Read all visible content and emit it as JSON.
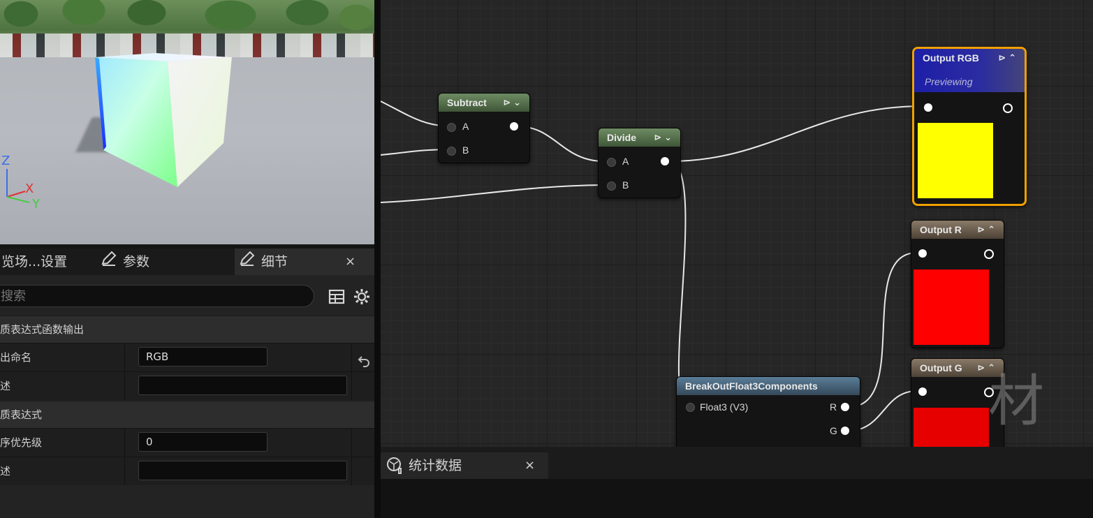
{
  "tabs": [
    {
      "label": "览场...设置",
      "active": false
    },
    {
      "label": "参数",
      "active": false
    },
    {
      "label": "细节",
      "active": true
    }
  ],
  "tab_close": "×",
  "search": {
    "placeholder": "搜索",
    "value": ""
  },
  "sections": [
    {
      "title": "质表达式函数输出"
    },
    {
      "title": "质表达式"
    }
  ],
  "props": {
    "output_name": {
      "label": "出命名",
      "value": "RGB"
    },
    "description1": {
      "label": "述",
      "value": ""
    },
    "sort_priority": {
      "label": "序优先级",
      "value": "0"
    },
    "description2": {
      "label": "述",
      "value": ""
    }
  },
  "viewport_axes": {
    "z": "Z",
    "x": "X",
    "y": "Y"
  },
  "nodes": {
    "subtract": {
      "title": "Subtract",
      "pins": [
        "A",
        "B"
      ]
    },
    "divide": {
      "title": "Divide",
      "pins": [
        "A",
        "B"
      ]
    },
    "output_rgb": {
      "title": "Output RGB",
      "subtitle": "Previewing",
      "preview_color": "#ffff00"
    },
    "output_r": {
      "title": "Output R",
      "preview_color": "#ff0000"
    },
    "output_g": {
      "title": "Output G",
      "preview_color": "#e60000"
    },
    "breakout": {
      "title": "BreakOutFloat3Components",
      "input": "Float3 (V3)",
      "outputs": [
        "R",
        "G"
      ]
    }
  },
  "watermark": "材质",
  "stats": {
    "tab_label": "统计数据",
    "close": "×"
  },
  "colors": {
    "accent_selected": "#f0a000",
    "header_green": "#56714c",
    "header_blue": "#4a6a83"
  }
}
